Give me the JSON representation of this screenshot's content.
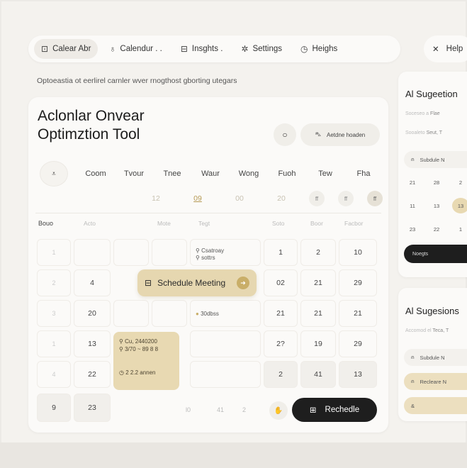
{
  "nav": {
    "items": [
      {
        "icon": "calendar-icon",
        "glyph": "⊡",
        "label": "Calear Abr",
        "active": true
      },
      {
        "icon": "user-icon",
        "glyph": "♁",
        "label": "Calendur . ."
      },
      {
        "icon": "lock-icon",
        "glyph": "⊟",
        "label": "Insghts ."
      },
      {
        "icon": "gear-icon",
        "glyph": "✲",
        "label": "Settings"
      },
      {
        "icon": "help-icon",
        "glyph": "◷",
        "label": "Heighs"
      }
    ],
    "close_label": "Help"
  },
  "subtitle": "Optoeastia ot eerlirel carnler wver rnogthost gborting utegars",
  "main": {
    "title_line1": "Aclonlar Onvear",
    "title_line2": "Optimztion Tool",
    "circle_btn_glyph": "○",
    "pill_btn_label": "Aetdne hoaden",
    "chevron_glyph": "⩡",
    "days": [
      "Coom",
      "Tvour",
      "Tnee",
      "Waur",
      "Wong",
      "Fuoh",
      "Tew",
      "Fha"
    ],
    "dates": [
      "12",
      "09",
      "00",
      "20"
    ],
    "date_dots": [
      "ff",
      "ff",
      "ff"
    ],
    "headers": [
      "Bouo",
      "Acto",
      "Mote",
      "Tegt",
      "Soto",
      "Boor",
      "Facbor"
    ],
    "row_labels": [
      "1",
      "2",
      "3",
      "1",
      "4",
      "9"
    ],
    "col_values": {
      "c1": [
        "4",
        "20",
        "13",
        "22",
        "23"
      ],
      "c5": [
        "1",
        "02",
        "21",
        "2?",
        "2"
      ],
      "c6": [
        "2",
        "21",
        "21",
        "19",
        "41"
      ],
      "c7": [
        "10",
        "29",
        "21",
        "29",
        "13"
      ]
    },
    "tag_top": [
      "Csatroay",
      "sottrs"
    ],
    "tag_mid": "30dbss",
    "meeting_label": "Schedule Meeting",
    "event_lines": [
      "Cu, 2440200",
      "3/70 ~ 89 8 8",
      "2 2.2 annen"
    ],
    "footer_nums": [
      "l0",
      "41",
      "2"
    ],
    "small_btn_glyph": "✋",
    "reschedule_label": "Rechedle"
  },
  "panel1": {
    "title": "Al Sugeetion",
    "meta1_prefix": "Soceseo a",
    "meta1_value": "Flae",
    "meta2_prefix": "Sooaleto",
    "meta2_value": "Seut, T",
    "row_label": "Subdule N",
    "grid": [
      "21",
      "28",
      "2",
      "11",
      "13",
      "13",
      "23",
      "22",
      "1"
    ],
    "dark_label": "Noegts"
  },
  "panel2": {
    "title": "Al Sugesions",
    "meta_prefix": "Accomod el",
    "meta_value": "Teca, T",
    "rows": [
      "Subdule N",
      "Recleare N",
      "&"
    ]
  },
  "colors": {
    "accent_gold": "#e6d7b0",
    "dark": "#1e1e1e",
    "background": "#f4f2ee"
  }
}
